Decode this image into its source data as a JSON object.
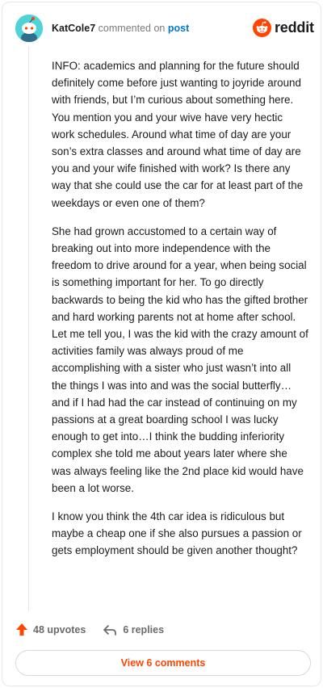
{
  "header": {
    "username": "KatCole7",
    "action_text": "commented on",
    "target_link": "post",
    "brand_wordmark": "reddit",
    "avatar_icon": "snoo-avatar-icon",
    "brand_icon": "reddit-alien-icon"
  },
  "comment": {
    "paragraphs": [
      "INFO: academics and planning for the future should definitely come before just wanting to joyride around with friends, but I’m curious about something here. You mention you and your wive have very hectic work schedules. Around what time of day are your son’s extra classes and around what time of day are you and your wife finished with work? Is there any way that she could use the car for at least part of the weekdays or even one of them?",
      "She had grown accustomed to a certain way of breaking out into more independence with the freedom to drive around for a year, when being social is something important for her. To go directly backwards to being the kid who has the gifted brother and hard working parents not at home after school. Let me tell you, I was the kid with the crazy amount of activities family was always proud of me accomplishing with a sister who just wasn’t into all the things I was into and was the social butterfly…and if I had had the car instead of continuing on my passions at a great boarding school I was lucky enough to get into…I think the budding inferiority complex she told me about years later where she was always feeling like the 2nd place kid would have been a lot worse.",
      "I know you think the 4th car idea is ridiculous but maybe a cheap one if she also pursues a passion or gets employment should be given another thought?"
    ]
  },
  "footer": {
    "upvotes_label": "48 upvotes",
    "replies_label": "6 replies",
    "view_comments_label": "View 6 comments"
  },
  "colors": {
    "accent": "#ff4500",
    "link": "#0079d3",
    "avatar_bg": "#4fd3d6"
  }
}
